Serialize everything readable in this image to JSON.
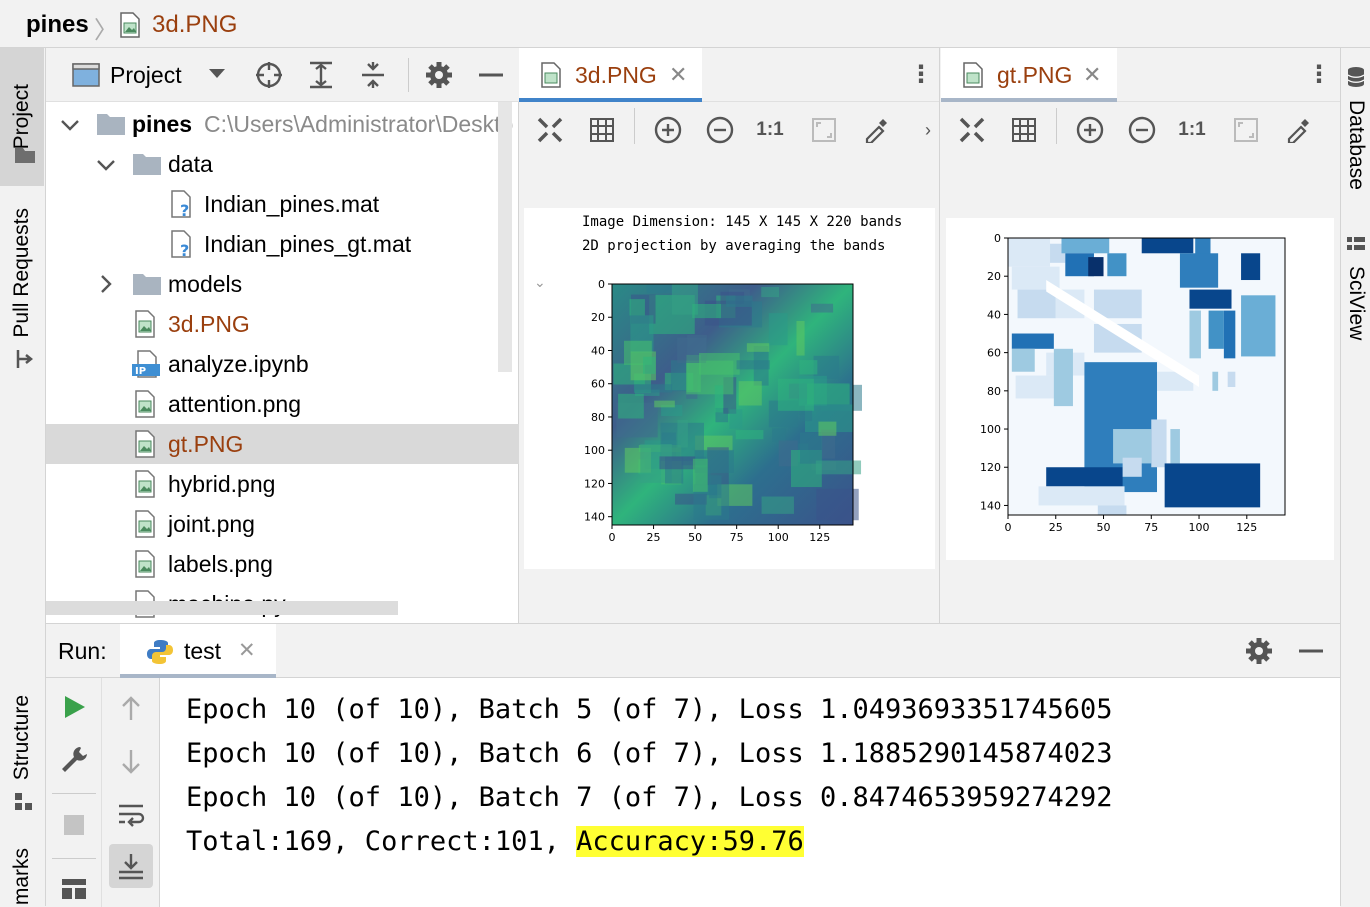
{
  "breadcrumb": {
    "project": "pines",
    "file": "3d.PNG"
  },
  "left_strip": {
    "project": "Project",
    "pull_requests": "Pull Requests",
    "structure": "Structure",
    "bookmarks": "marks"
  },
  "right_strip": {
    "database": "Database",
    "sciview": "SciView"
  },
  "project_panel": {
    "title": "Project",
    "tree": [
      {
        "label": "pines",
        "extra": "C:\\Users\\Administrator\\Deskto",
        "type": "folder-root"
      },
      {
        "label": "data",
        "type": "folder"
      },
      {
        "label": "Indian_pines.mat",
        "type": "unknown"
      },
      {
        "label": "Indian_pines_gt.mat",
        "type": "unknown"
      },
      {
        "label": "models",
        "type": "folder"
      },
      {
        "label": "3d.PNG",
        "type": "image"
      },
      {
        "label": "analyze.ipynb",
        "type": "ipynb"
      },
      {
        "label": "attention.png",
        "type": "image"
      },
      {
        "label": "gt.PNG",
        "type": "image"
      },
      {
        "label": "hybrid.png",
        "type": "image"
      },
      {
        "label": "joint.png",
        "type": "image"
      },
      {
        "label": "labels.png",
        "type": "image"
      },
      {
        "label": "machine.py",
        "type": "python"
      }
    ]
  },
  "editor1": {
    "tab": "3d.PNG",
    "image": {
      "line1": "Image Dimension: 145 X 145 X 220 bands",
      "line2": "2D projection by averaging the bands"
    },
    "chart_data": {
      "type": "heatmap",
      "title": "",
      "x_ticks": [
        "0",
        "25",
        "50",
        "75",
        "100",
        "125"
      ],
      "y_ticks": [
        "0",
        "20",
        "40",
        "60",
        "80",
        "100",
        "120",
        "140"
      ],
      "colormap": "viridis"
    }
  },
  "editor2": {
    "tab": "gt.PNG",
    "chart_data": {
      "type": "heatmap",
      "title": "",
      "x_ticks": [
        "0",
        "25",
        "50",
        "75",
        "100",
        "125"
      ],
      "y_ticks": [
        "0",
        "20",
        "40",
        "60",
        "80",
        "100",
        "120",
        "140"
      ],
      "colormap": "Blues"
    }
  },
  "run": {
    "label": "Run:",
    "tab": "test",
    "lines": [
      "Epoch 10 (of 10), Batch 5 (of 7), Loss 1.0493693351745605",
      "Epoch 10 (of 10), Batch 6 (of 7), Loss 1.1885290145874023",
      "Epoch 10 (of 10), Batch 7 (of 7), Loss 0.8474653959274292"
    ],
    "summary_prefix": "Total:169, Correct:101, ",
    "summary_highlight": "Accuracy:59.76"
  },
  "colors": {
    "accent": "#4083c9",
    "modified": "#9a3f0e",
    "highlight": "#ffff33"
  }
}
